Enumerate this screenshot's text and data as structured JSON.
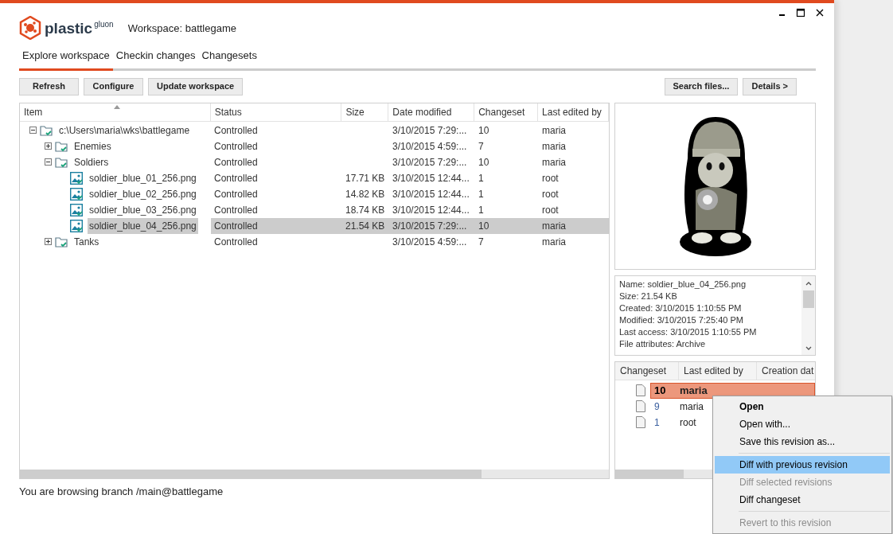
{
  "window": {
    "workspace_title": "Workspace: battlegame",
    "logo": {
      "name": "plastic",
      "suffix": "gluon"
    }
  },
  "tabs": [
    {
      "label": "Explore workspace",
      "selected": true
    },
    {
      "label": "Checkin changes",
      "selected": false
    },
    {
      "label": "Changesets",
      "selected": false
    }
  ],
  "toolbar": {
    "left": [
      "Refresh",
      "Configure",
      "Update workspace"
    ],
    "right": [
      "Search files...",
      "Details >"
    ]
  },
  "tree": {
    "columns": [
      "Item",
      "Status",
      "Size",
      "Date modified",
      "Changeset",
      "Last edited by"
    ],
    "rows": [
      {
        "kind": "folder",
        "name": "c:\\Users\\maria\\wks\\battlegame",
        "status": "Controlled",
        "date": "3/10/2015 7:29:...",
        "changeset": "10",
        "edited_by": "maria",
        "expanded": true,
        "selected": false,
        "children": [
          {
            "kind": "folder",
            "name": "Enemies",
            "status": "Controlled",
            "date": "3/10/2015 4:59:...",
            "changeset": "7",
            "edited_by": "maria",
            "expanded": false,
            "selected": false
          },
          {
            "kind": "folder",
            "name": "Soldiers",
            "status": "Controlled",
            "date": "3/10/2015 7:29:...",
            "changeset": "10",
            "edited_by": "maria",
            "expanded": true,
            "selected": false,
            "children": [
              {
                "kind": "image",
                "name": "soldier_blue_01_256.png",
                "status": "Controlled",
                "size": "17.71 KB",
                "date": "3/10/2015 12:44...",
                "changeset": "1",
                "edited_by": "root",
                "selected": false
              },
              {
                "kind": "image",
                "name": "soldier_blue_02_256.png",
                "status": "Controlled",
                "size": "14.82 KB",
                "date": "3/10/2015 12:44...",
                "changeset": "1",
                "edited_by": "root",
                "selected": false
              },
              {
                "kind": "image",
                "name": "soldier_blue_03_256.png",
                "status": "Controlled",
                "size": "18.74 KB",
                "date": "3/10/2015 12:44...",
                "changeset": "1",
                "edited_by": "root",
                "selected": false
              },
              {
                "kind": "image",
                "name": "soldier_blue_04_256.png",
                "status": "Controlled",
                "size": "21.54 KB",
                "date": "3/10/2015 7:29:...",
                "changeset": "10",
                "edited_by": "maria",
                "selected": true
              }
            ]
          },
          {
            "kind": "folder",
            "name": "Tanks",
            "status": "Controlled",
            "date": "3/10/2015 4:59:...",
            "changeset": "7",
            "edited_by": "maria",
            "expanded": false,
            "selected": false
          }
        ]
      }
    ]
  },
  "file_info": [
    "Name: soldier_blue_04_256.png",
    "Size: 21.54 KB",
    "Created: 3/10/2015 1:10:55 PM",
    "Modified: 3/10/2015 7:25:40 PM",
    "Last access: 3/10/2015 1:10:55 PM",
    "File attributes: Archive"
  ],
  "revisions": {
    "columns": [
      "Changeset",
      "Last edited by",
      "Creation dat"
    ],
    "rows": [
      {
        "changeset": "10",
        "edited_by": "maria",
        "selected": true
      },
      {
        "changeset": "9",
        "edited_by": "maria",
        "selected": false
      },
      {
        "changeset": "1",
        "edited_by": "root",
        "selected": false
      }
    ]
  },
  "context_menu": [
    {
      "kind": "item",
      "label": "Open",
      "bold": true,
      "highlighted": false,
      "disabled": false
    },
    {
      "kind": "item",
      "label": "Open with...",
      "bold": false,
      "highlighted": false,
      "disabled": false
    },
    {
      "kind": "item",
      "label": "Save this revision as...",
      "bold": false,
      "highlighted": false,
      "disabled": false
    },
    {
      "kind": "separator"
    },
    {
      "kind": "item",
      "label": "Diff with previous revision",
      "bold": false,
      "highlighted": true,
      "disabled": false
    },
    {
      "kind": "item",
      "label": "Diff selected revisions",
      "bold": false,
      "highlighted": false,
      "disabled": true
    },
    {
      "kind": "item",
      "label": "Diff changeset",
      "bold": false,
      "highlighted": false,
      "disabled": false
    },
    {
      "kind": "separator"
    },
    {
      "kind": "item",
      "label": "Revert to this revision",
      "bold": false,
      "highlighted": false,
      "disabled": true
    }
  ],
  "status_bar": "You are browsing branch /main@battlegame"
}
